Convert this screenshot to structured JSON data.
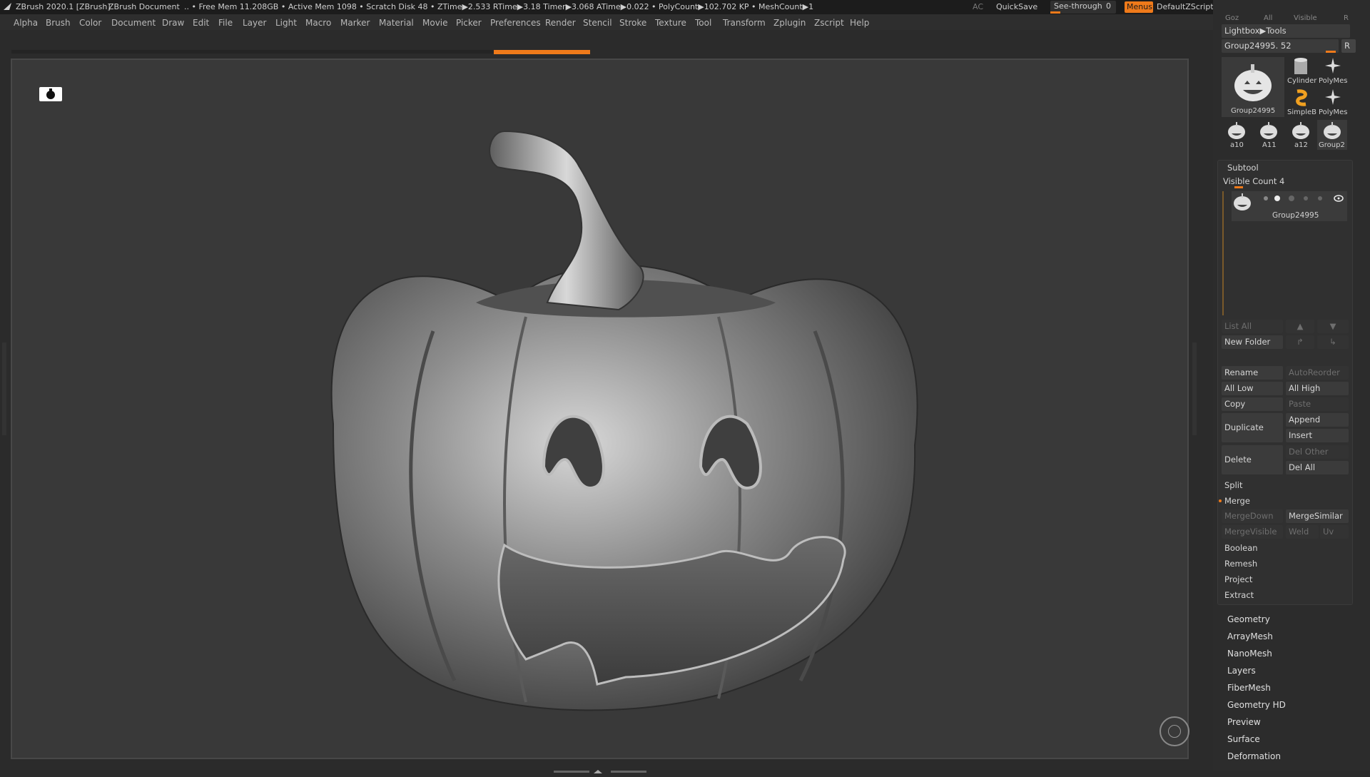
{
  "titlebar": {
    "app": "ZBrush 2020.1 [ZBrush]",
    "document": "ZBrush Document",
    "stats": ".. • Free Mem 11.208GB • Active Mem 1098 • Scratch Disk 48 • ZTime▶2.533 RTime▶3.18 Timer▶3.068 ATime▶0.022 • PolyCount▶102.702 KP • MeshCount▶1",
    "ac": "AC",
    "quicksave": "QuickSave",
    "see_through_label": "See-through",
    "see_through_value": "0",
    "menus": "Menus",
    "zscript": "DefaultZScript"
  },
  "menubar": {
    "items": [
      "Alpha",
      "Brush",
      "Color",
      "Document",
      "Draw",
      "Edit",
      "File",
      "Layer",
      "Light",
      "Macro",
      "Marker",
      "Material",
      "Movie",
      "Picker",
      "Preferences",
      "Render",
      "Stencil",
      "Stroke",
      "Texture",
      "Tool",
      "Transform",
      "Zplugin",
      "Zscript",
      "Help"
    ]
  },
  "progress": {
    "value": 0.17
  },
  "tool_panel": {
    "top_partial": [
      "Goz",
      "All",
      "Visible",
      "R"
    ],
    "lightbox_tools": "Lightbox▶Tools",
    "current_tool": "Group24995. 52",
    "r_button": "R",
    "main_thumb_label": "Group24995",
    "thumbs": [
      {
        "label": "Cylinder",
        "icon": "cylinder-icon"
      },
      {
        "label": "PolyMes",
        "icon": "polymesh-star-icon"
      },
      {
        "label": "SimpleB",
        "icon": "simplebrush-icon"
      },
      {
        "label": "PolyMes",
        "icon": "polymesh-star-icon"
      },
      {
        "label": "a10",
        "icon": "pumpkin-icon"
      },
      {
        "label": "A11",
        "icon": "pumpkin-icon"
      },
      {
        "label": "a12",
        "icon": "pumpkin-icon"
      },
      {
        "label": "Group2",
        "icon": "pumpkin-icon"
      }
    ]
  },
  "subtool": {
    "title": "Subtool",
    "visible_count": "Visible Count 4",
    "item_label": "Group24995",
    "list_all": "List All",
    "new_folder": "New Folder",
    "rename": "Rename",
    "autoreorder": "AutoReorder",
    "all_low": "All Low",
    "all_high": "All High",
    "copy": "Copy",
    "paste": "Paste",
    "duplicate": "Duplicate",
    "append": "Append",
    "insert": "Insert",
    "delete": "Delete",
    "del_other": "Del Other",
    "del_all": "Del All",
    "split": "Split",
    "merge": "Merge",
    "merge_down": "MergeDown",
    "merge_similar": "MergeSimilar",
    "merge_visible": "MergeVisible",
    "weld": "Weld",
    "uv": "Uv",
    "boolean": "Boolean",
    "remesh": "Remesh",
    "project": "Project",
    "extract": "Extract"
  },
  "tool_submenus": [
    "Geometry",
    "ArrayMesh",
    "NanoMesh",
    "Layers",
    "FiberMesh",
    "Geometry HD",
    "Preview",
    "Surface",
    "Deformation"
  ],
  "colors": {
    "accent": "#ef7a1a",
    "panel": "#2c2c2c",
    "viewport": "#393939"
  }
}
